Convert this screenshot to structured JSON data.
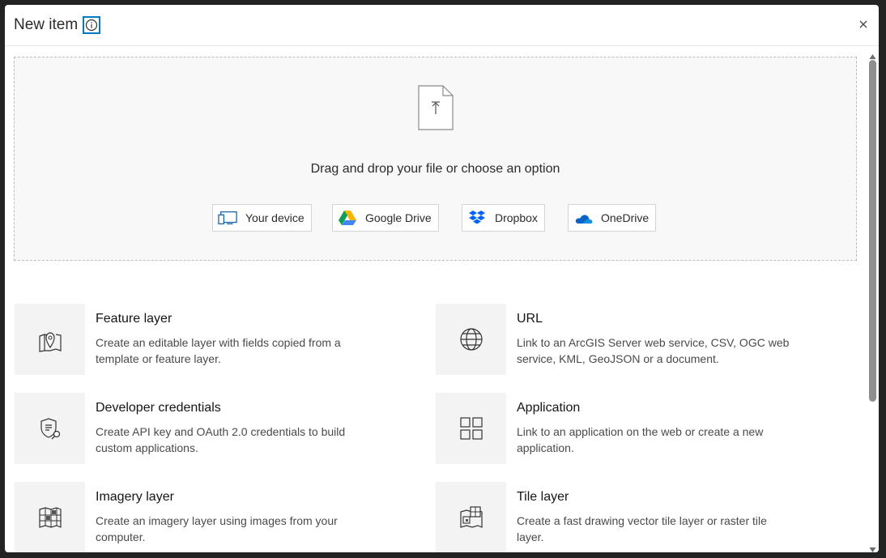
{
  "modal": {
    "title": "New item",
    "info_icon": "info-icon",
    "close_icon": "close-icon"
  },
  "dropzone": {
    "upload_icon": "file-upload-icon",
    "prompt": "Drag and drop your file or choose an option",
    "sources": [
      {
        "label": "Your device",
        "icon": "device-icon"
      },
      {
        "label": "Google Drive",
        "icon": "google-drive-icon"
      },
      {
        "label": "Dropbox",
        "icon": "dropbox-icon"
      },
      {
        "label": "OneDrive",
        "icon": "onedrive-icon"
      }
    ]
  },
  "items": [
    {
      "title": "Feature layer",
      "description": "Create an editable layer with fields copied from a template or feature layer.",
      "icon": "map-pin-icon"
    },
    {
      "title": "URL",
      "description": "Link to an ArcGIS Server web service, CSV, OGC web service, KML, GeoJSON or a document.",
      "icon": "globe-icon"
    },
    {
      "title": "Developer credentials",
      "description": "Create API key and OAuth 2.0 credentials to build custom applications.",
      "icon": "credentials-icon"
    },
    {
      "title": "Application",
      "description": "Link to an application on the web or create a new application.",
      "icon": "grid-icon"
    },
    {
      "title": "Imagery layer",
      "description": "Create an imagery layer using images from your computer.",
      "icon": "imagery-icon"
    },
    {
      "title": "Tile layer",
      "description": "Create a fast drawing vector tile layer or raster tile layer.",
      "icon": "tile-layer-icon"
    }
  ],
  "colors": {
    "accent": "#007ac2",
    "google_green": "#0f9d58",
    "google_yellow": "#f4b400",
    "google_blue": "#4285f4",
    "dropbox_blue": "#0061fe",
    "onedrive_blue": "#0a64c8"
  }
}
